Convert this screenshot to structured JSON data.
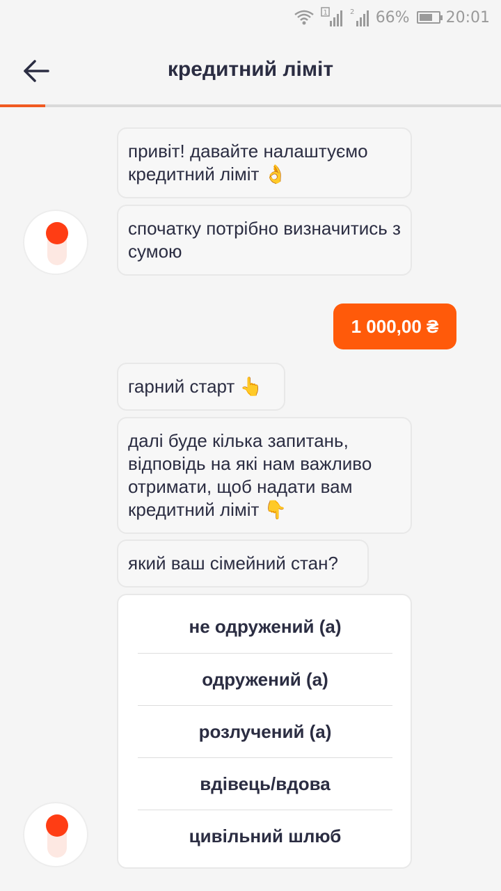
{
  "status_bar": {
    "battery": "66%",
    "time": "20:01",
    "sim1": "1",
    "sim2": "2"
  },
  "header": {
    "title": "кредитний ліміт",
    "progress_fraction": 0.09
  },
  "messages": [
    {
      "from": "bot",
      "text": "привіт! давайте налаштуємо кредитний ліміт 👌"
    },
    {
      "from": "bot",
      "text": "спочатку потрібно визначитись з сумою"
    },
    {
      "from": "user",
      "text": "1 000,00 ₴"
    },
    {
      "from": "bot",
      "text": "гарний старт 👆"
    },
    {
      "from": "bot",
      "text": "далі буде кілька запитань, відповідь на які нам важливо отримати, щоб надати вам кредитний ліміт 👇"
    },
    {
      "from": "bot",
      "text": "який ваш сімейний стан?"
    }
  ],
  "options": [
    "не одружений (а)",
    "одружений (а)",
    "розлучений (а)",
    "вдівець/вдова",
    "цивільний шлюб"
  ],
  "colors": {
    "accent": "#ff5a0a",
    "avatar_knob": "#ff3d14",
    "text": "#2b2d42"
  },
  "icons": {
    "back": "arrow-left-icon",
    "wifi": "wifi-icon",
    "signal": "signal-icon",
    "battery": "battery-icon"
  }
}
